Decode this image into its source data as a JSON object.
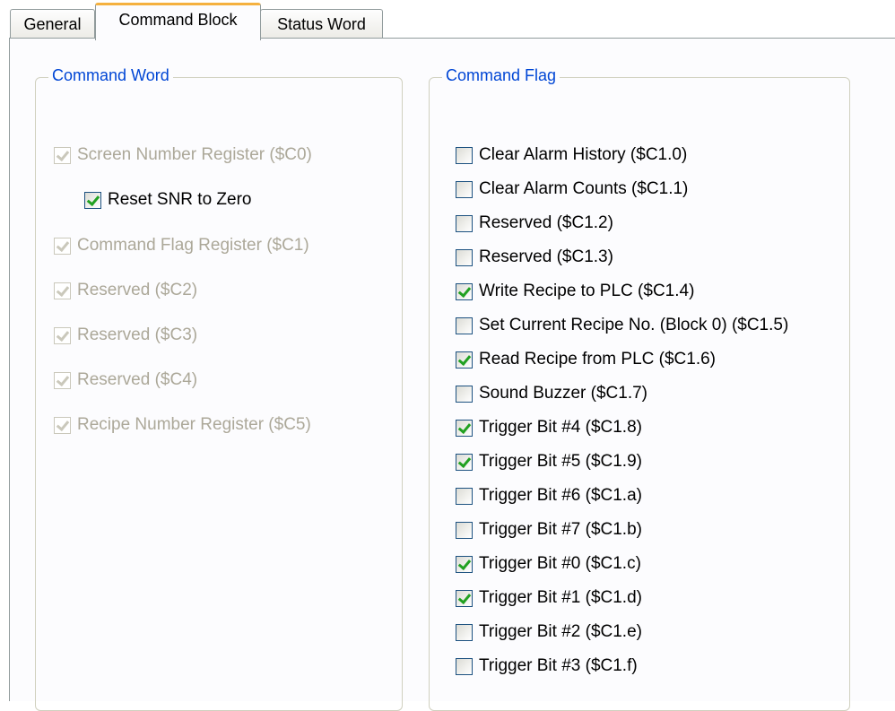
{
  "tabs": [
    {
      "label": "General",
      "active": false
    },
    {
      "label": "Command Block",
      "active": true
    },
    {
      "label": "Status Word",
      "active": false
    }
  ],
  "command_word": {
    "title": "Command Word",
    "items": [
      {
        "label": "Screen Number Register ($C0)",
        "checked": true,
        "enabled": false
      },
      {
        "label": "Reset SNR to Zero",
        "checked": true,
        "enabled": true
      },
      {
        "label": "Command Flag Register ($C1)",
        "checked": true,
        "enabled": false
      },
      {
        "label": "Reserved ($C2)",
        "checked": true,
        "enabled": false
      },
      {
        "label": "Reserved ($C3)",
        "checked": true,
        "enabled": false
      },
      {
        "label": "Reserved ($C4)",
        "checked": true,
        "enabled": false
      },
      {
        "label": "Recipe Number Register ($C5)",
        "checked": true,
        "enabled": false
      }
    ]
  },
  "command_flag": {
    "title": "Command Flag",
    "items": [
      {
        "label": "Clear Alarm History ($C1.0)",
        "checked": false
      },
      {
        "label": "Clear Alarm Counts ($C1.1)",
        "checked": false
      },
      {
        "label": "Reserved ($C1.2)",
        "checked": false
      },
      {
        "label": "Reserved ($C1.3)",
        "checked": false
      },
      {
        "label": "Write Recipe to PLC ($C1.4)",
        "checked": true
      },
      {
        "label": "Set Current Recipe No. (Block 0) ($C1.5)",
        "checked": false
      },
      {
        "label": "Read Recipe from PLC ($C1.6)",
        "checked": true
      },
      {
        "label": "Sound Buzzer ($C1.7)",
        "checked": false
      },
      {
        "label": "Trigger Bit #4 ($C1.8)",
        "checked": true
      },
      {
        "label": "Trigger Bit #5 ($C1.9)",
        "checked": true
      },
      {
        "label": "Trigger Bit #6 ($C1.a)",
        "checked": false
      },
      {
        "label": "Trigger Bit #7 ($C1.b)",
        "checked": false
      },
      {
        "label": "Trigger Bit #0 ($C1.c)",
        "checked": true
      },
      {
        "label": "Trigger Bit #1 ($C1.d)",
        "checked": true
      },
      {
        "label": "Trigger Bit #2 ($C1.e)",
        "checked": false
      },
      {
        "label": "Trigger Bit #3 ($C1.f)",
        "checked": false
      }
    ]
  }
}
